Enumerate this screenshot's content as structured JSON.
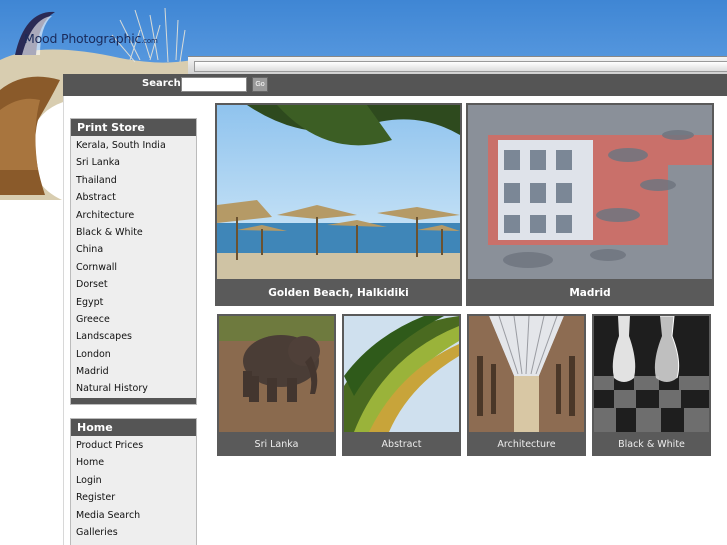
{
  "brand": {
    "logo_name": "Mood Photographic",
    "logo_domain": ".com"
  },
  "search": {
    "label": "Search:",
    "value": "",
    "placeholder": "",
    "go_label": "Go"
  },
  "print_store": {
    "title": "Print Store",
    "items": [
      "Kerala, South India",
      "Sri Lanka",
      "Thailand",
      "Abstract",
      "Architecture",
      "Black & White",
      "China",
      "Cornwall",
      "Dorset",
      "Egypt",
      "Greece",
      "Landscapes",
      "London",
      "Madrid",
      "Natural History"
    ]
  },
  "home_menu": {
    "title": "Home",
    "items": [
      "Product Prices",
      "Home",
      "Login",
      "Register",
      "Media Search",
      "Galleries"
    ]
  },
  "featured": [
    {
      "caption": "Golden Beach, Halkidiki"
    },
    {
      "caption": "Madrid"
    }
  ],
  "gallery": [
    {
      "caption": "Sri Lanka"
    },
    {
      "caption": "Abstract"
    },
    {
      "caption": "Architecture"
    },
    {
      "caption": "Black & White"
    }
  ],
  "colors": {
    "header_blue": "#4a8fdb",
    "bar_gray": "#555555",
    "panel_gray": "#eeeeee"
  }
}
